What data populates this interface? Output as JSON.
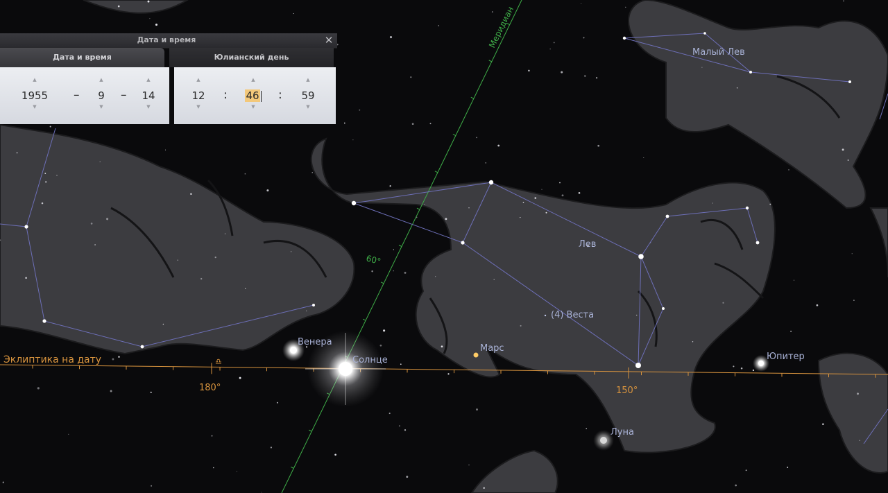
{
  "window": {
    "title": "Дата и время",
    "tabs": [
      "Дата и время",
      "Юлианский день"
    ],
    "date": {
      "year": "1955",
      "month": "9",
      "day": "14",
      "separator": "–"
    },
    "time": {
      "hour": "12",
      "minute": "46",
      "second": "59",
      "separator": ":"
    }
  },
  "sky": {
    "constellations": {
      "leo": "Лев",
      "leo_minor": "Малый Лев"
    },
    "objects": {
      "venus": "Венера",
      "sun": "Солнце",
      "mars": "Марс",
      "vesta": "(4) Веста",
      "jupiter": "Юпитер",
      "moon": "Луна"
    },
    "ecliptic_label": "Эклиптика на дату",
    "ecliptic_ticks": [
      "180°",
      "150°"
    ],
    "meridian_label": "Меридиан",
    "meridian_tick": "60°",
    "libra_symbol": "♎"
  },
  "colors": {
    "ecliptic": "#d9943e",
    "meridian": "#3fae48",
    "constellation_line": "#6d6fb8",
    "label": "#a9b2d6",
    "panel": "#e3e6ec"
  }
}
